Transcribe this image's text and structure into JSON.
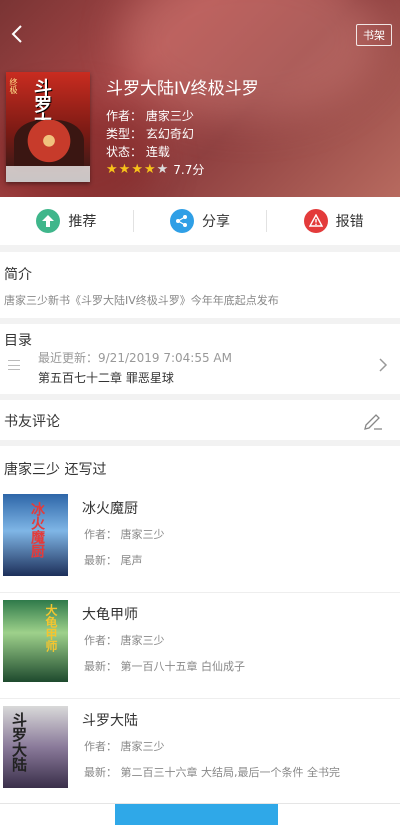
{
  "header": {
    "back_icon": "chevron-left-icon",
    "shelf_label": "书架"
  },
  "book": {
    "title": "斗罗大陆IV终极斗罗",
    "author": "作者：  唐家三少",
    "genre": "类型：  玄幻奇幻",
    "status": "状态：  连载",
    "stars_filled": 4,
    "stars_total": 5,
    "score": "7.7分",
    "cover_title": "斗罗大陆",
    "cover_small": "终极"
  },
  "actions": [
    {
      "label": "推荐",
      "icon": "upload-arrow-icon",
      "color": "#3fb68b"
    },
    {
      "label": "分享",
      "icon": "share-icon",
      "color": "#2f9fe6"
    },
    {
      "label": "报错",
      "icon": "warning-icon",
      "color": "#e33b3b"
    }
  ],
  "intro": {
    "title": "简介",
    "text": "唐家三少新书《斗罗大陆IV终极斗罗》今年年底起点发布"
  },
  "toc": {
    "title": "目录",
    "updated": "最近更新：9/21/2019 7:04:55 AM",
    "latest_chapter": "第五百七十二章 罪恶星球"
  },
  "comments": {
    "title": "书友评论"
  },
  "author_books": {
    "title": "唐家三少  还写过",
    "items": [
      {
        "name": "冰火魔厨",
        "author": "作者：  唐家三少",
        "latest": "最新：  尾声",
        "cover_text": "冰火魔厨"
      },
      {
        "name": "大龟甲师",
        "author": "作者：  唐家三少",
        "latest": "最新：  第一百八十五章 白仙成子",
        "cover_text": "大龟甲师"
      },
      {
        "name": "斗罗大陆",
        "author": "作者：  唐家三少",
        "latest": "最新：  第二百三十六章 大结局,最后一个条件 全书完",
        "cover_text": "斗罗大陆"
      }
    ]
  },
  "bottom_bar": {
    "left": "",
    "middle": "",
    "right": ""
  }
}
